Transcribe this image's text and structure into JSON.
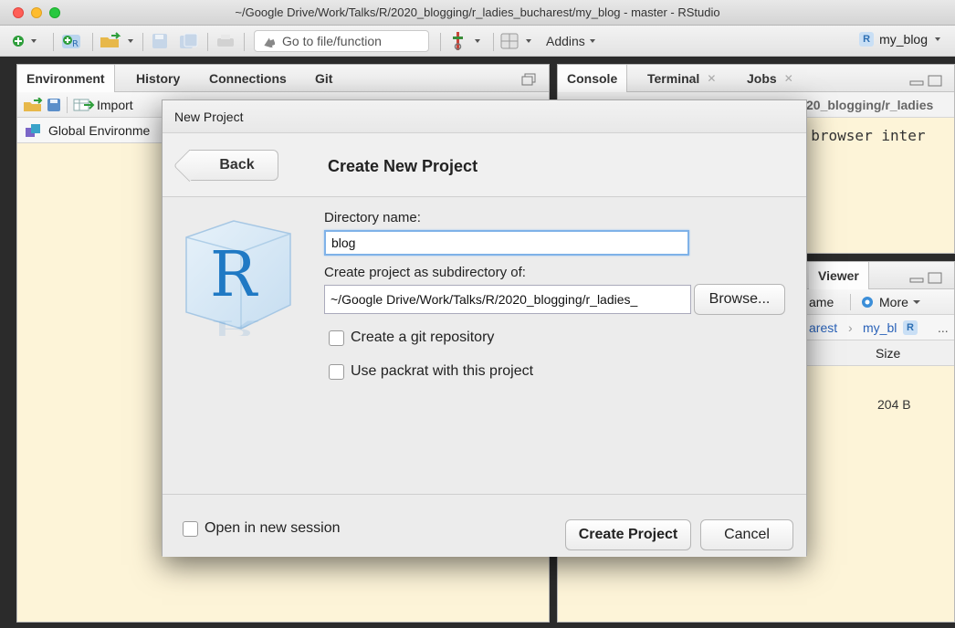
{
  "window": {
    "title": "~/Google Drive/Work/Talks/R/2020_blogging/r_ladies_bucharest/my_blog - master - RStudio"
  },
  "toolbar": {
    "goto_placeholder": "Go to file/function",
    "addins": "Addins",
    "project_name": "my_blog",
    "r_glyph": "R"
  },
  "left_pane": {
    "tabs": [
      "Environment",
      "History",
      "Connections",
      "Git"
    ],
    "import_label": "Import",
    "global_env": "Global Environme"
  },
  "right_top_pane": {
    "tabs": [
      "Console",
      "Terminal",
      "Jobs"
    ],
    "path_fragment": "20_blogging/r_ladies",
    "console_fragment": "L browser inter"
  },
  "right_bottom_pane": {
    "tab_viewer": "Viewer",
    "rename_fragment": "ame",
    "more": "More",
    "breadcrumb_a": "arest",
    "breadcrumb_b": "my_bl",
    "col_size": "Size",
    "row_size": "204 B"
  },
  "dialog": {
    "title": "New Project",
    "back": "Back",
    "heading": "Create New Project",
    "dir_label": "Directory name:",
    "dir_value": "blog",
    "sub_label": "Create project as subdirectory of:",
    "sub_value": "~/Google Drive/Work/Talks/R/2020_blogging/r_ladies_",
    "browse": "Browse...",
    "git_label": "Create a git repository",
    "packrat_label": "Use packrat with this project",
    "new_session_label": "Open in new session",
    "create": "Create Project",
    "cancel": "Cancel",
    "logo_letter": "R"
  }
}
